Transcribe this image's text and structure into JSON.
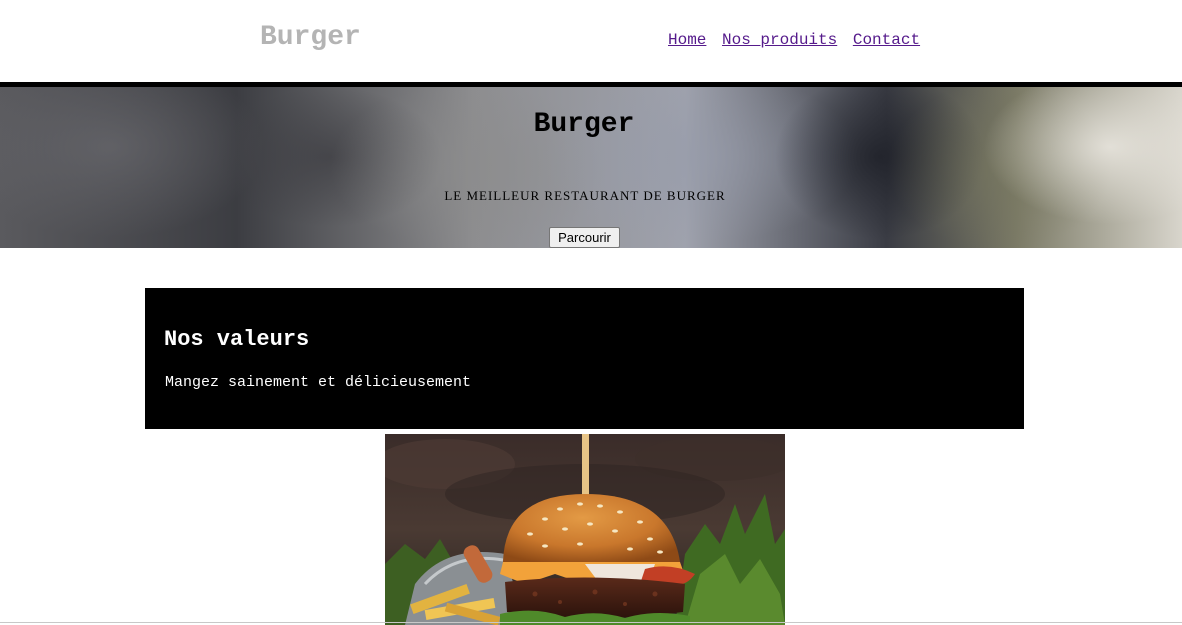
{
  "header": {
    "brand": "Burger",
    "nav": [
      "Home",
      "Nos produits",
      "Contact"
    ]
  },
  "hero": {
    "title": "Burger",
    "subtitle": "LE MEILLEUR RESTAURANT DE BURGER",
    "button_label": "Parcourir"
  },
  "values": {
    "title": "Nos valeurs",
    "text": "Mangez sainement et délicieusement"
  },
  "colors": {
    "brand": "#b4b4b4",
    "link": "#551a8b",
    "values_background": "#000000",
    "values_text": "#ffffff"
  }
}
